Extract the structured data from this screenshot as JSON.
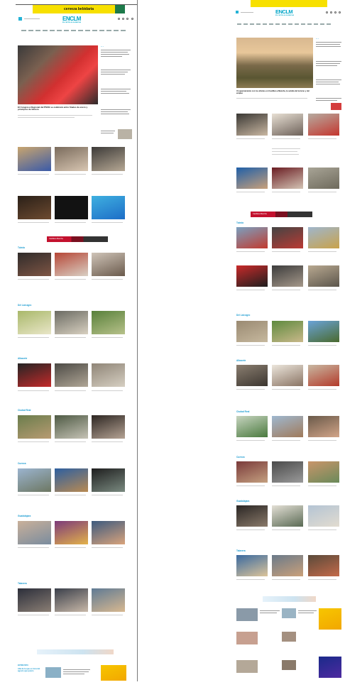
{
  "ad_banner_left": "cerveza bebidaria",
  "ad_banner_right": "",
  "logo": {
    "text": "ENCLM",
    "tagline": "EN CASTILLA-LA MANCHA"
  },
  "lead_left": {
    "headline": "El Congreso Regional del PSOE se celebrará entre finales de enero y principios de febrero"
  },
  "lead_right": {
    "headline": "Un aparcamiento con los árboles en Castilla-La Mancha, la subida del turismo y del empleo",
    "badge": "SOCIALISTAS"
  },
  "sections_left": [
    "Toledo",
    "Del Lab agro",
    "Albacete",
    "Ciudad Real",
    "Cuenca",
    "Guadalajara",
    "Talavera"
  ],
  "sections_right": [
    "Toledo",
    "Del Lab agro",
    "Albacete",
    "Ciudad Real",
    "Cuenca",
    "Guadalajara",
    "Talavera"
  ],
  "promo": {
    "word": "Castilla-la Mancha"
  },
  "bottom_left": {
    "headline": "Alta de la que es hora del agosto que quiero",
    "label": "ENTREVISTA"
  }
}
